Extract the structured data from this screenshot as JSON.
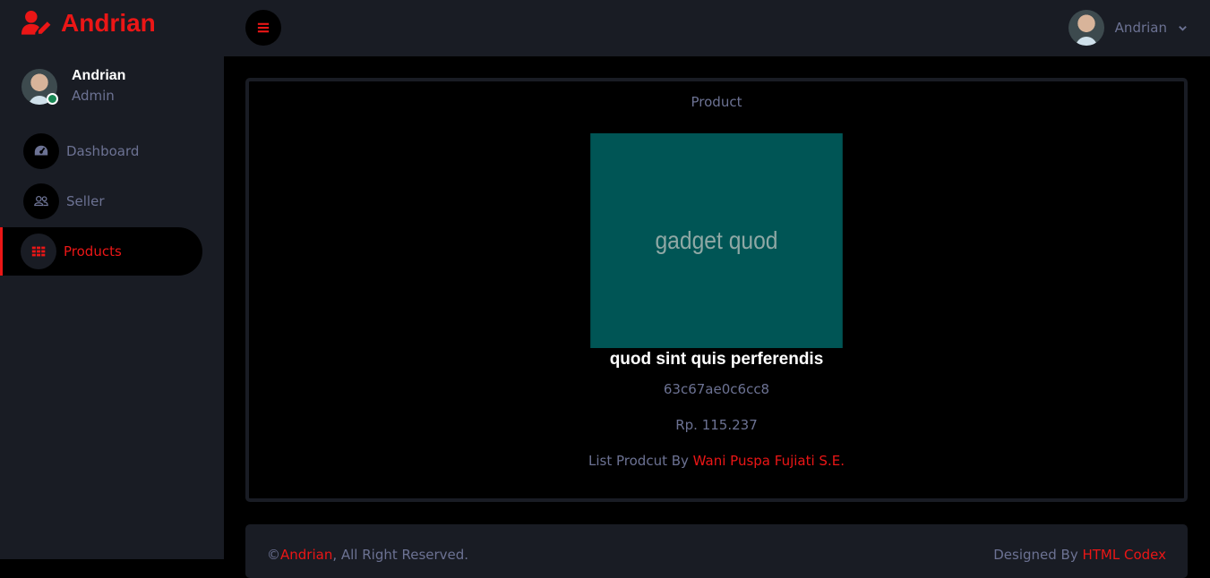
{
  "brand": {
    "name": "Andrian",
    "icon": "user-edit-icon"
  },
  "profile": {
    "name": "Andrian",
    "role": "Admin"
  },
  "sidebar": {
    "items": [
      {
        "label": "Dashboard",
        "icon": "tachometer-icon"
      },
      {
        "label": "Seller",
        "icon": "users-icon"
      },
      {
        "label": "Products",
        "icon": "grid-icon",
        "active": true
      }
    ]
  },
  "topbar": {
    "toggle_icon": "bars-icon",
    "user_name": "Andrian"
  },
  "product": {
    "section_title": "Product",
    "image_text": "gadget quod",
    "image_color": "#005555",
    "name": "quod sint quis perferendis",
    "id": "63c67ae0c6cc8",
    "price": "Rp. 115.237",
    "list_prefix": "List Prodcut By ",
    "seller": "Wani Puspa Fujiati S.E."
  },
  "footer": {
    "copyright_symbol": "©",
    "owner": "Andrian",
    "rights": ", All Right Reserved.",
    "designed_prefix": "Designed By ",
    "designer": "HTML Codex"
  },
  "colors": {
    "accent": "#eb1616",
    "panel": "#191c24",
    "muted": "#6c7293"
  }
}
